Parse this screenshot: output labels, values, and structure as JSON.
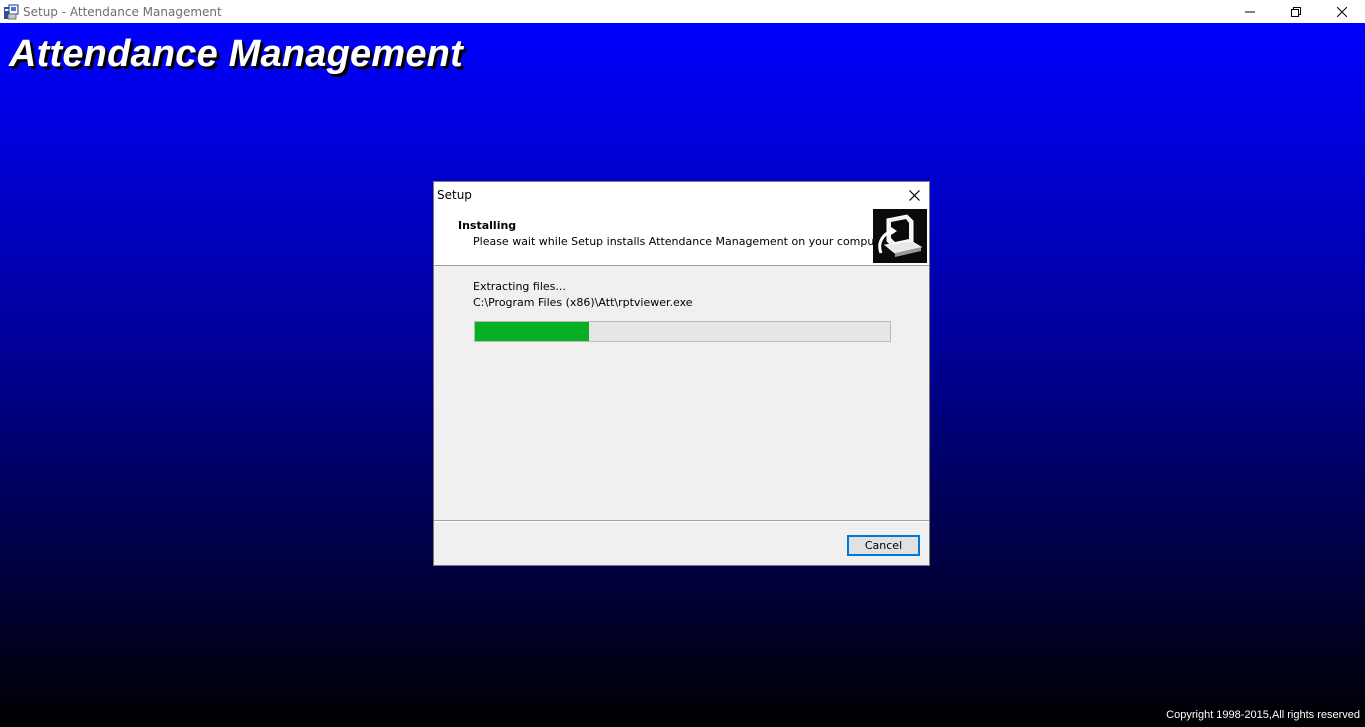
{
  "window": {
    "title": "Setup - Attendance Management",
    "icons": {
      "app": "setup-app-icon",
      "minimize": "minimize-icon",
      "restore": "restore-icon",
      "close": "close-icon"
    }
  },
  "backdrop": {
    "title": "Attendance Management",
    "copyright": "Copyright 1998-2015,All rights reserved",
    "colors": {
      "top": "#0000ff",
      "bottom": "#000000",
      "title_text": "#ffffff"
    }
  },
  "dialog": {
    "title": "Setup",
    "header": {
      "heading": "Installing",
      "subheading": "Please wait while Setup installs Attendance Management on your computer.",
      "image": "computer-install-icon"
    },
    "status": "Extracting files...",
    "current_file": "C:\\Program Files (x86)\\Att\\rptviewer.exe",
    "progress": {
      "fraction": 0.274,
      "color": "#06b025"
    },
    "cancel_label": "Cancel"
  }
}
